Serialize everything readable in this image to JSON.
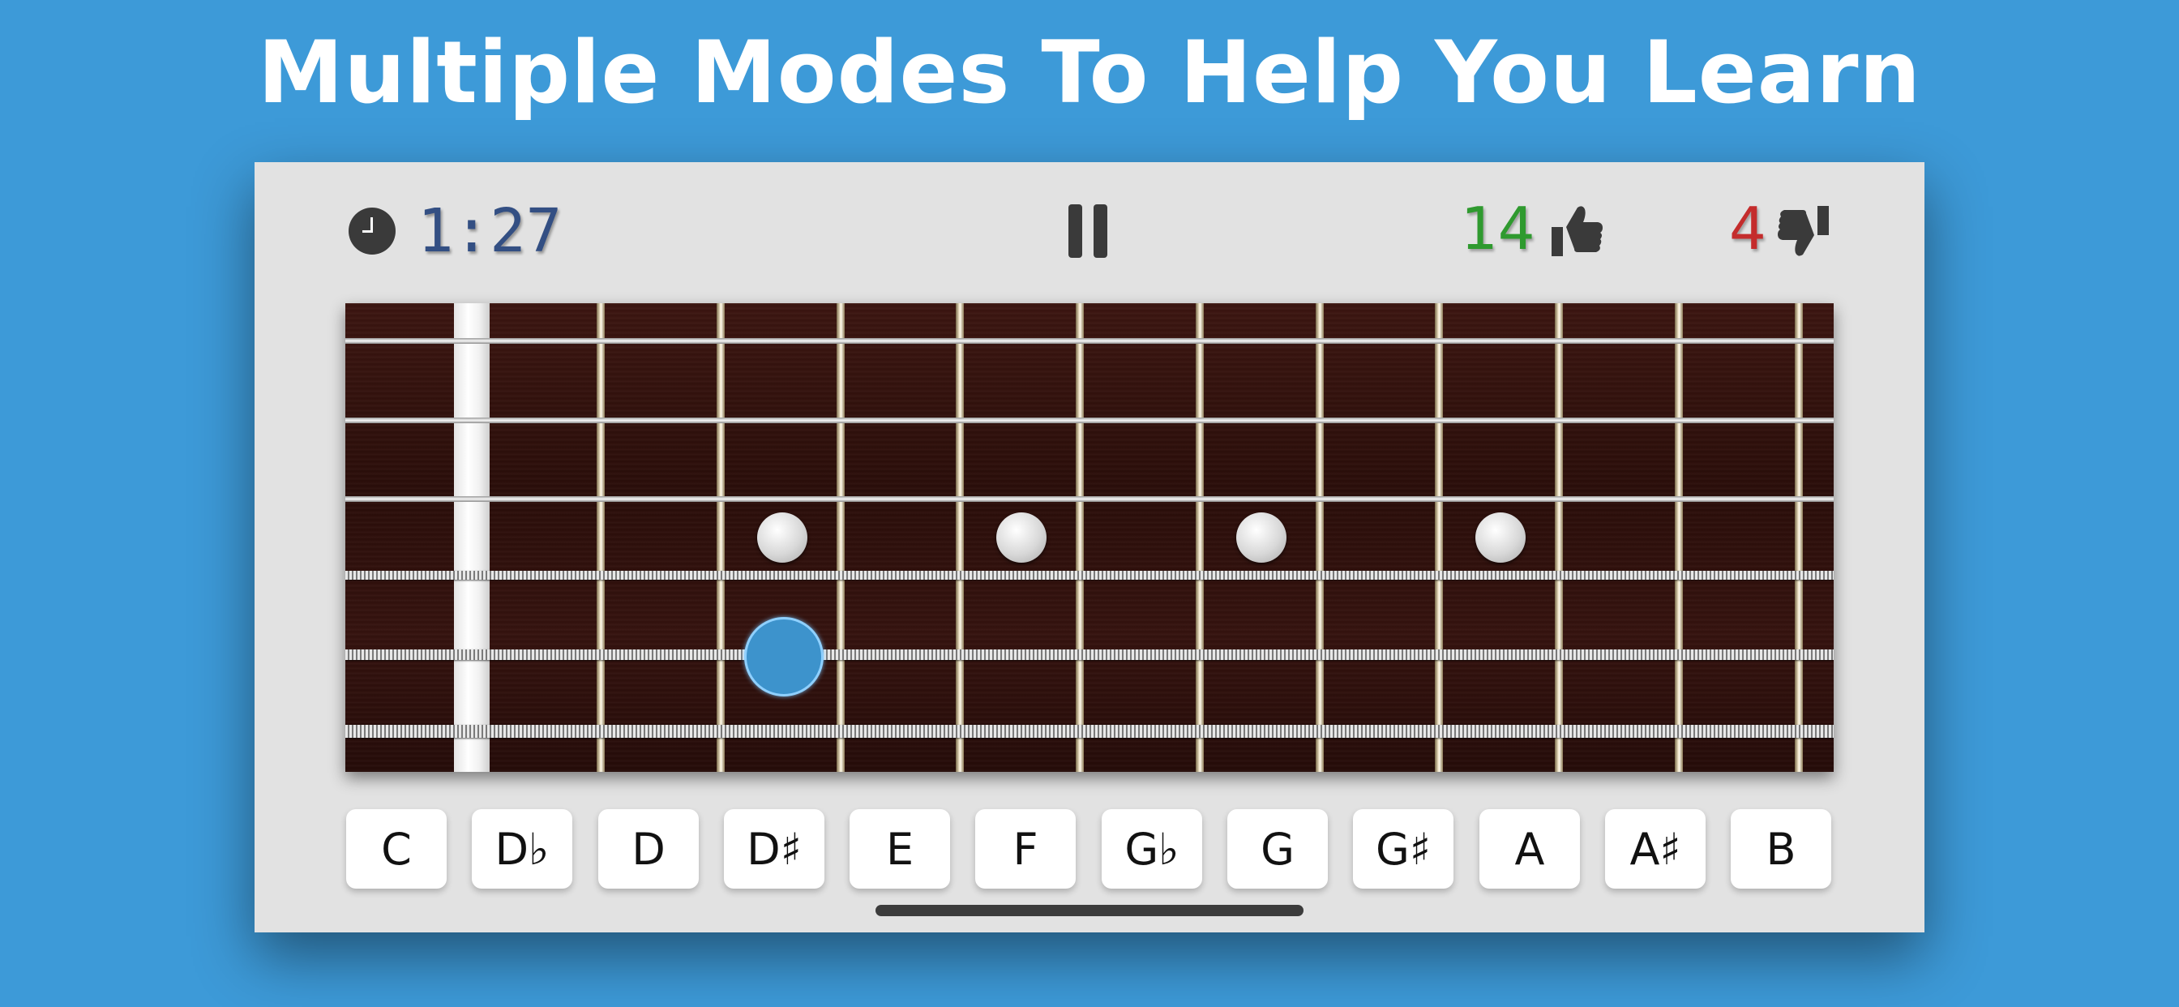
{
  "headline": "Multiple Modes To Help You Learn",
  "status": {
    "timer": "1:27",
    "correct": "14",
    "wrong": "4"
  },
  "icons": {
    "clock": "clock-icon",
    "pause": "pause-icon",
    "correct": "thumbs-up-icon",
    "wrong": "thumbs-down-icon"
  },
  "notes": [
    "C",
    "D♭",
    "D",
    "D♯",
    "E",
    "F",
    "G♭",
    "G",
    "G♯",
    "A",
    "A♯",
    "B"
  ],
  "colors": {
    "background": "#3d9ad8",
    "timer": "#334f83",
    "correct": "#2f9a2f",
    "wrong": "#c42c2c",
    "target": "#3d93cc"
  }
}
